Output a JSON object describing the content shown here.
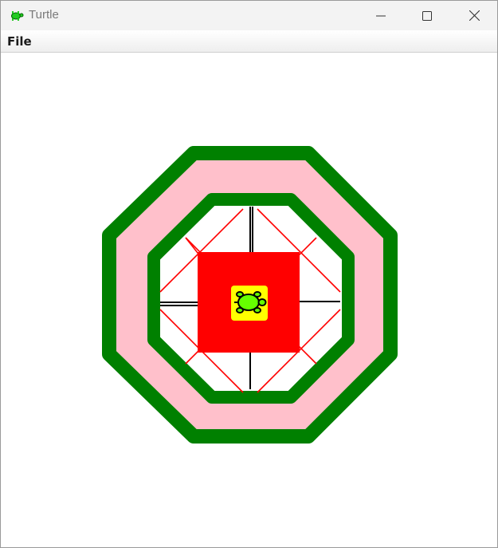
{
  "window": {
    "title": "Turtle",
    "app_icon": "turtle-icon",
    "controls": [
      "minimize-icon",
      "maximize-icon",
      "close-icon"
    ]
  },
  "menu": {
    "items": [
      {
        "label": "File"
      }
    ]
  },
  "drawing": {
    "colors": {
      "outer_octagon_stroke": "#008000",
      "outer_octagon_fill": "#ffc0cb",
      "inner_octagon_stroke": "#008000",
      "inner_octagon_fill": "#ffffff",
      "diagonal_lines": "#ff0000",
      "cross_lines": "#000000",
      "center_square": "#ff0000",
      "turtle_background": "#ffff00",
      "turtle_body": "#66ff00"
    },
    "turtle_icon": "turtle-icon"
  }
}
